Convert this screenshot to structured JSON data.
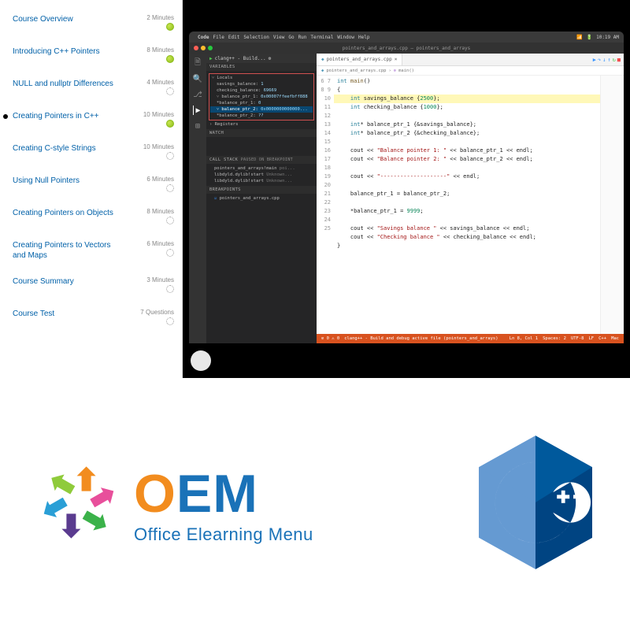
{
  "colors": {
    "oem_orange": "#f28c1e",
    "oem_blue": "#1a72b8",
    "cpp_blue_dark": "#004482",
    "cpp_blue_mid": "#00599c",
    "cpp_blue_light": "#659ad2",
    "status_orange": "#d8521f"
  },
  "nav": {
    "items": [
      {
        "label": "Course Overview",
        "duration": "2 Minutes",
        "status": "done"
      },
      {
        "label": "Introducing C++ Pointers",
        "duration": "8 Minutes",
        "status": "done"
      },
      {
        "label": "NULL and nullptr Differences",
        "duration": "4 Minutes",
        "status": "loading"
      },
      {
        "label": "Creating Pointers in C++",
        "duration": "10 Minutes",
        "status": "done",
        "current": true
      },
      {
        "label": "Creating C-style Strings",
        "duration": "10 Minutes",
        "status": "loading"
      },
      {
        "label": "Using Null Pointers",
        "duration": "6 Minutes",
        "status": "loading"
      },
      {
        "label": "Creating Pointers on Objects",
        "duration": "8 Minutes",
        "status": "loading"
      },
      {
        "label": "Creating Pointers to Vectors and Maps",
        "duration": "6 Minutes",
        "status": "loading"
      },
      {
        "label": "Course Summary",
        "duration": "3 Minutes",
        "status": "loading"
      },
      {
        "label": "Course Test",
        "duration": "7 Questions",
        "status": "loading"
      }
    ]
  },
  "mac_menu": {
    "app": "Code",
    "items": [
      "File",
      "Edit",
      "Selection",
      "View",
      "Go",
      "Run",
      "Terminal",
      "Window",
      "Help"
    ],
    "clock": "10:19 AM"
  },
  "vscode": {
    "title_center": "pointers_and_arrays.cpp — pointers_and_arrays",
    "debug_toolbar": {
      "config": "clang++ - Build..."
    },
    "tab": {
      "name": "pointers_and_arrays.cpp"
    },
    "breadcrumb": [
      "pointers_and_arrays.cpp",
      "main()"
    ],
    "variables_header": "VARIABLES",
    "locals_label": "Locals",
    "locals": [
      {
        "name": "savings_balance",
        "value": "1"
      },
      {
        "name": "checking_balance",
        "value": "69669"
      },
      {
        "name": "balance_ptr_1",
        "value": "0x00007ffeefbff888"
      },
      {
        "name": "*balance_ptr_1",
        "value": "0"
      },
      {
        "name": "balance_ptr_2",
        "value": "0x0000000000000...",
        "highlight": true
      },
      {
        "name": "*balance_ptr_2",
        "value": "??"
      }
    ],
    "registers_label": "Registers",
    "watch_header": "WATCH",
    "callstack_header": "CALL STACK",
    "callstack_state": "PAUSED ON BREAKPOINT",
    "callstack": [
      {
        "frame": "pointers_and_arrays!main",
        "loc": "poi..."
      },
      {
        "frame": "libdyld.dylib!start",
        "loc": "Unknown..."
      },
      {
        "frame": "libdyld.dylib!start",
        "loc": "Unknown..."
      }
    ],
    "breakpoints_header": "BREAKPOINTS",
    "breakpoints": [
      {
        "label": "pointers_and_arrays.cpp",
        "checked": true
      }
    ],
    "gutter_start": 6,
    "code_lines": [
      {
        "html": "<span class='ty'>int</span> <span class='fn'>main</span>()"
      },
      {
        "html": "{"
      },
      {
        "html": "    <span class='ty'>int</span> savings_balance {<span class='num'>2500</span>};",
        "highlight": true
      },
      {
        "html": "    <span class='ty'>int</span> checking_balance {<span class='num'>1000</span>};"
      },
      {
        "html": ""
      },
      {
        "html": "    <span class='ty'>int</span>* balance_ptr_1 {&amp;savings_balance};"
      },
      {
        "html": "    <span class='ty'>int</span>* balance_ptr_2 {&amp;checking_balance};"
      },
      {
        "html": ""
      },
      {
        "html": "    cout &lt;&lt; <span class='str'>\"Balance pointer 1: \"</span> &lt;&lt; balance_ptr_1 &lt;&lt; endl;"
      },
      {
        "html": "    cout &lt;&lt; <span class='str'>\"Balance pointer 2: \"</span> &lt;&lt; balance_ptr_2 &lt;&lt; endl;"
      },
      {
        "html": ""
      },
      {
        "html": "    cout &lt;&lt; <span class='str'>\"--------------------\"</span> &lt;&lt; endl;"
      },
      {
        "html": ""
      },
      {
        "html": "    balance_ptr_1 = balance_ptr_2;"
      },
      {
        "html": ""
      },
      {
        "html": "    *balance_ptr_1 = <span class='num'>9999</span>;"
      },
      {
        "html": ""
      },
      {
        "html": "    cout &lt;&lt; <span class='str'>\"Savings balance \"</span> &lt;&lt; savings_balance &lt;&lt; endl;"
      },
      {
        "html": "    cout &lt;&lt; <span class='str'>\"Checking balance \"</span> &lt;&lt; checking_balance &lt;&lt; endl;"
      },
      {
        "html": "}"
      }
    ],
    "status": {
      "left": [
        "⊘ 0 ⚠ 0",
        "clang++ - Build and debug active file (pointers_and_arrays)"
      ],
      "right": [
        "Ln 8, Col 1",
        "Spaces: 2",
        "UTF-8",
        "LF",
        "C++",
        "Mac"
      ]
    }
  },
  "logos": {
    "oem_big": "OEM",
    "oem_sub": "Office Elearning Menu",
    "cpp_text": "C++"
  }
}
